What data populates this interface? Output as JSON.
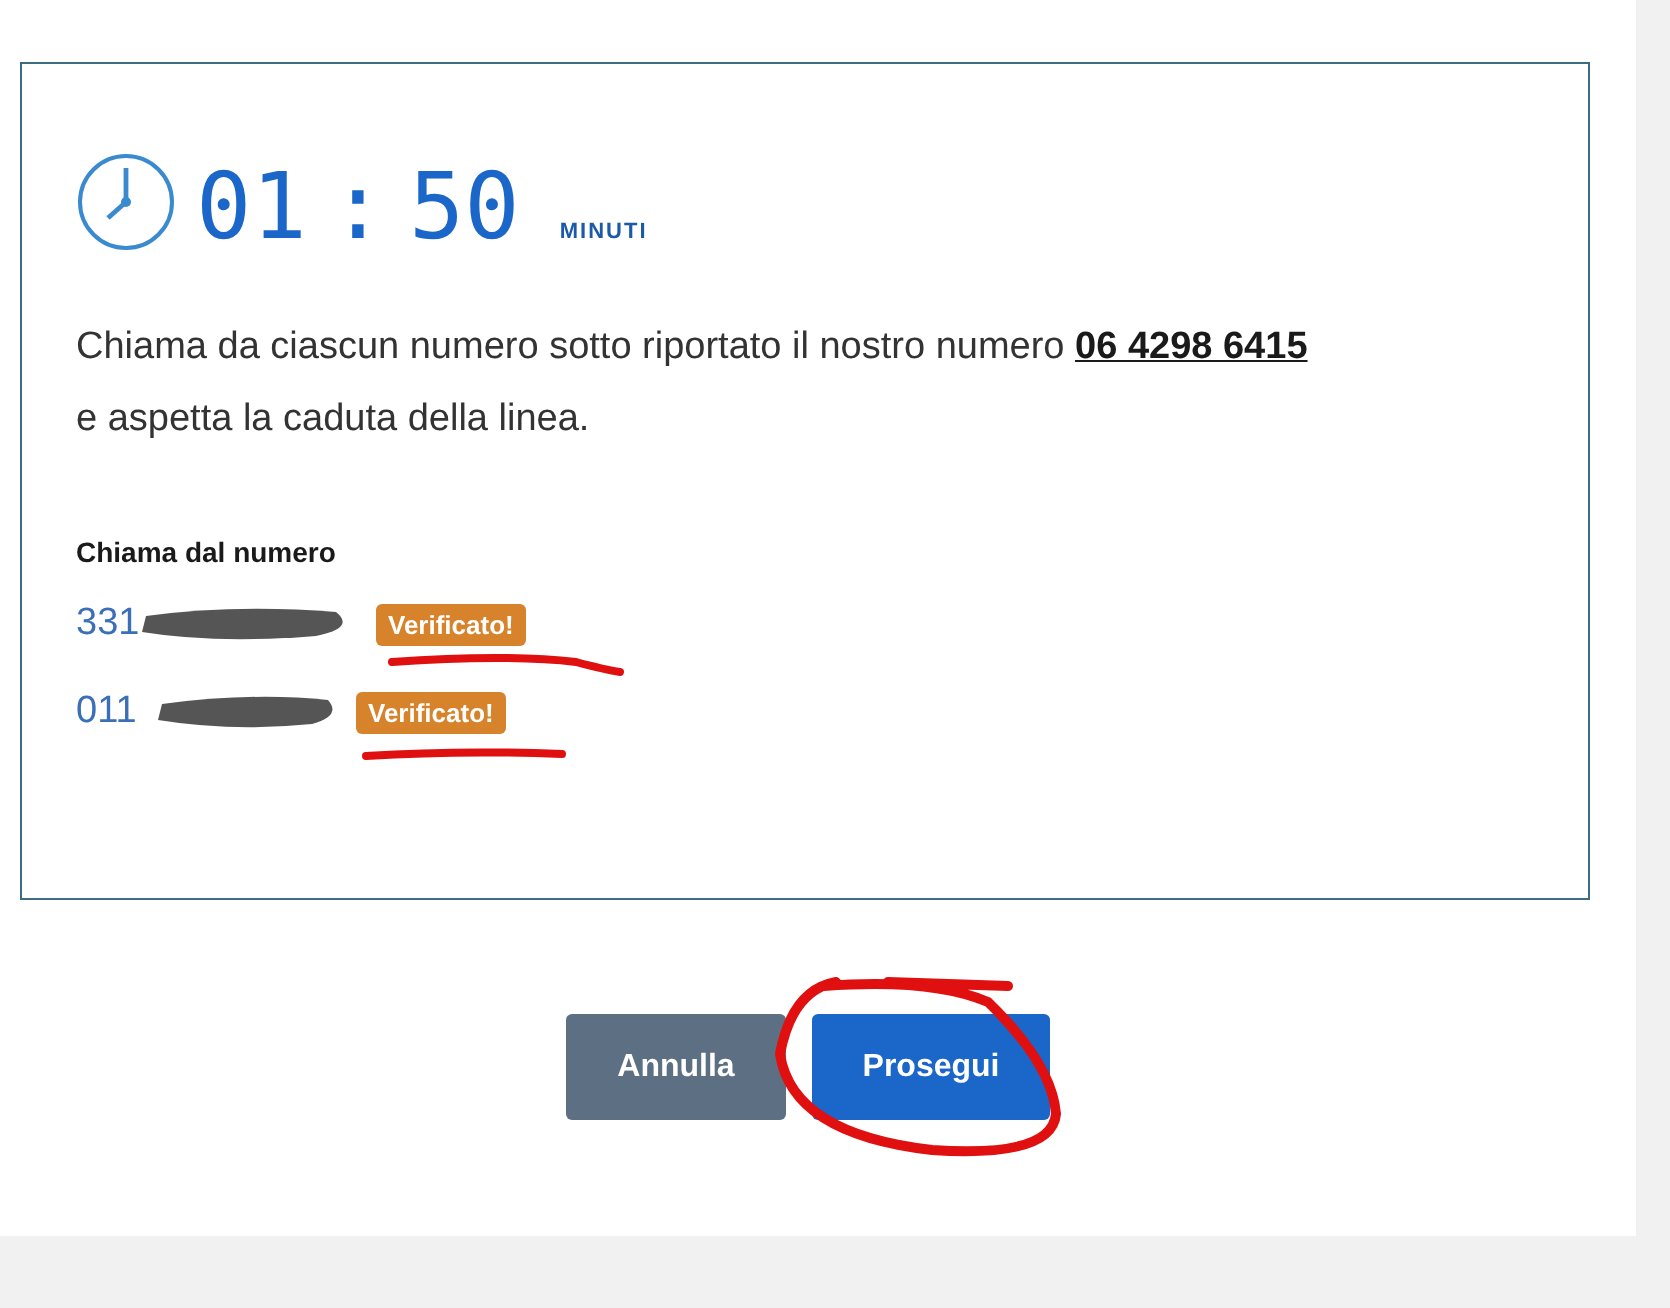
{
  "timer": {
    "time": "01 : 50",
    "unit": "MINUTI"
  },
  "instructions": {
    "text": "Chiama da ciascun numero sotto riportato il nostro numero ",
    "number": "06 4298 6415",
    "after": "e aspetta la caduta della linea."
  },
  "numbers_heading": "Chiama dal numero",
  "numbers": [
    {
      "visible": "331",
      "redacted": true,
      "badge": "Verificato!",
      "underlined": true
    },
    {
      "visible": "011",
      "redacted": true,
      "badge": "Verificato!",
      "underlined": true
    }
  ],
  "buttons": [
    {
      "label": "Annulla",
      "kind": "secondary",
      "circled": false
    },
    {
      "label": "Prosegui",
      "kind": "primary",
      "circled": true
    }
  ]
}
